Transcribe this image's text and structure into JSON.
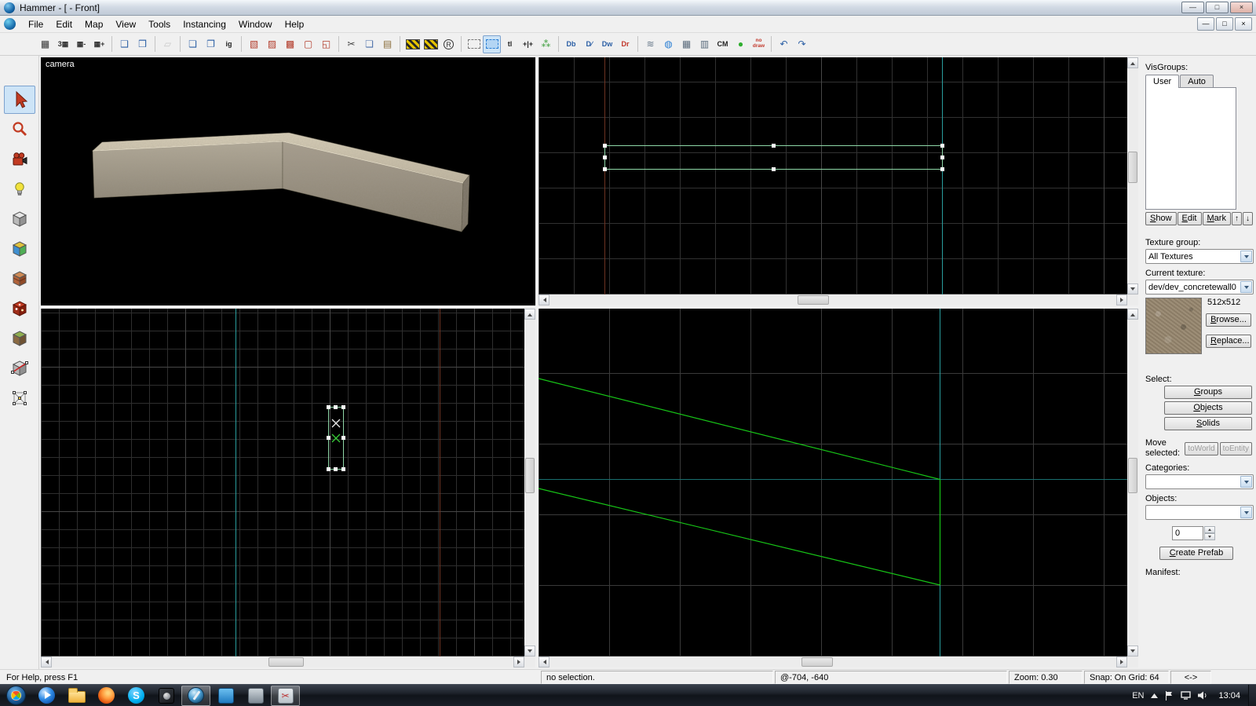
{
  "titlebar": {
    "title": "Hammer - [ - Front]",
    "minimize_glyph": "—",
    "maximize_glyph": "□",
    "close_glyph": "×"
  },
  "menubar": {
    "items": [
      {
        "label": "File",
        "name": "menu-file"
      },
      {
        "label": "Edit",
        "name": "menu-edit"
      },
      {
        "label": "Map",
        "name": "menu-map"
      },
      {
        "label": "View",
        "name": "menu-view"
      },
      {
        "label": "Tools",
        "name": "menu-tools"
      },
      {
        "label": "Instancing",
        "name": "menu-instancing"
      },
      {
        "label": "Window",
        "name": "menu-window"
      },
      {
        "label": "Help",
        "name": "menu-help"
      }
    ],
    "mdi_minimize": "—",
    "mdi_restore": "□",
    "mdi_close": "×"
  },
  "toolbar": {
    "buttons": [
      {
        "name": "toggle-grid-icon",
        "glyph": "▦",
        "color": "#333333"
      },
      {
        "name": "toggle-3d-grid-icon",
        "glyph": "3▦",
        "color": "#333333",
        "cls": "small-text"
      },
      {
        "name": "smaller-grid-icon",
        "glyph": "▦-",
        "color": "#333333",
        "cls": "small-text"
      },
      {
        "name": "larger-grid-icon",
        "glyph": "▦+",
        "color": "#333333",
        "cls": "small-text"
      },
      {
        "sep": true
      },
      {
        "name": "load-window-state-icon",
        "glyph": "❑",
        "color": "#2b5fa5"
      },
      {
        "name": "save-window-state-icon",
        "glyph": "❒",
        "color": "#2b5fa5"
      },
      {
        "sep": true
      },
      {
        "name": "carve-icon",
        "glyph": "▱",
        "color": "#9a9a9a",
        "disabled": true
      },
      {
        "sep": true
      },
      {
        "name": "group-icon",
        "glyph": "❏",
        "color": "#2b5fa5"
      },
      {
        "name": "ungroup-icon",
        "glyph": "❐",
        "color": "#2b5fa5"
      },
      {
        "name": "ignore-groups-icon",
        "glyph": "ig",
        "color": "#222222",
        "cls": "small-text"
      },
      {
        "sep": true
      },
      {
        "name": "hide-selected-icon",
        "glyph": "▧",
        "color": "#b23b2a"
      },
      {
        "name": "hide-unselected-icon",
        "glyph": "▨",
        "color": "#b23b2a"
      },
      {
        "name": "show-all-icon",
        "glyph": "▩",
        "color": "#b23b2a"
      },
      {
        "name": "cordon-toggle-icon",
        "glyph": "▢",
        "color": "#b23b2a"
      },
      {
        "name": "cordon-edit-icon",
        "glyph": "◱",
        "color": "#b23b2a"
      },
      {
        "sep": true
      },
      {
        "name": "cut-icon",
        "glyph": "✂",
        "color": "#444444"
      },
      {
        "name": "copy-icon",
        "glyph": "❏",
        "color": "#4a6ea9"
      },
      {
        "name": "paste-icon",
        "glyph": "▤",
        "color": "#8a6d3b"
      },
      {
        "sep": true
      },
      {
        "name": "texture-lock-icon",
        "cls": "hazard"
      },
      {
        "name": "texture-scale-lock-icon",
        "cls": "hazard"
      },
      {
        "name": "model-render-distance-icon",
        "glyph": "R",
        "color": "#333333",
        "cls": "circled"
      },
      {
        "sep": true
      },
      {
        "name": "select-box-icon",
        "cls": "dashed-box"
      },
      {
        "name": "auto-select-icon",
        "cls": "dashed-box-blue",
        "active": true
      },
      {
        "name": "texture-lock-tl-icon",
        "glyph": "tl",
        "color": "#222222",
        "cls": "small-text"
      },
      {
        "name": "edge-align-icon",
        "glyph": "+|+",
        "color": "#222222",
        "cls": "small-text"
      },
      {
        "name": "foliage-icon",
        "glyph": "⁂",
        "color": "#3d9e3d"
      },
      {
        "sep": true
      },
      {
        "name": "disp-boundary-icon",
        "glyph": "Db",
        "color": "#2b5fa5",
        "cls": "small-text"
      },
      {
        "name": "disp-collision-icon",
        "glyph": "D∕",
        "color": "#2b5fa5",
        "cls": "small-text"
      },
      {
        "name": "disp-walkable-icon",
        "glyph": "Dw",
        "color": "#2b5fa5",
        "cls": "small-text"
      },
      {
        "name": "disp-remove-icon",
        "glyph": "Dr",
        "color": "#c2372a",
        "cls": "small-text"
      },
      {
        "sep": true
      },
      {
        "name": "sound-browser-icon",
        "glyph": "≋",
        "color": "#6b7c8d"
      },
      {
        "name": "model-browser-icon",
        "glyph": "◍",
        "color": "#2b7fd4"
      },
      {
        "name": "entity-report-icon",
        "glyph": "▦",
        "color": "#5a6b7c"
      },
      {
        "name": "face-edit-icon",
        "glyph": "▥",
        "color": "#5a6b7c"
      },
      {
        "name": "cordon-mode-icon",
        "glyph": "CM",
        "color": "#222222",
        "cls": "small-text"
      },
      {
        "name": "run-map-icon",
        "glyph": "●",
        "color": "#2fae2f"
      },
      {
        "name": "nodraw-icon",
        "glyph": "no\ndraw",
        "color": "#c2372a",
        "cls": "tiny-text"
      },
      {
        "sep": true
      },
      {
        "name": "undo-icon",
        "glyph": "↶",
        "color": "#2b5fa5"
      },
      {
        "name": "redo-icon",
        "glyph": "↷",
        "color": "#2b5fa5"
      }
    ]
  },
  "tool_palette": {
    "tools": [
      "selection",
      "magnify",
      "camera",
      "entity",
      "block",
      "texture-application",
      "apply-current-texture",
      "apply-decals",
      "apply-overlays",
      "clipping",
      "vertex-manipulation"
    ],
    "active_tool": "selection"
  },
  "viewports": {
    "camera_label": "camera",
    "colors": {
      "background": "#000000",
      "grid_line": "#313131",
      "grid_major_line": "#474747",
      "selection_outline": "#8fd8a8",
      "brush_wireframe": "#17c517",
      "axis_teal": "#2a9d9d",
      "axis_brown": "#6e3322",
      "handle": "#ffffff"
    }
  },
  "right_panel": {
    "visgroups_label": "VisGroups:",
    "tabs": [
      {
        "label": "User",
        "name": "tab-user",
        "active": true
      },
      {
        "label": "Auto",
        "name": "tab-auto"
      }
    ],
    "show_btn": "Show",
    "edit_btn": "Edit",
    "mark_btn": "Mark",
    "up_btn": "↑",
    "down_btn": "↓",
    "texture_group_label": "Texture group:",
    "texture_group_value": "All Textures",
    "current_texture_label": "Current texture:",
    "current_texture_value": "dev/dev_concretewall0",
    "texture_size": "512x512",
    "browse_btn": "Browse...",
    "replace_btn": "Replace...",
    "select_label": "Select:",
    "groups_btn": "Groups",
    "objects_btn": "Objects",
    "solids_btn": "Solids",
    "move_label_1": "Move",
    "move_label_2": "selected:",
    "toworld_btn": "toWorld",
    "toentity_btn": "toEntity",
    "categories_label": "Categories:",
    "objects_label": "Objects:",
    "prefab_count": "0",
    "create_prefab_btn": "Create Prefab",
    "manifest_label": "Manifest:"
  },
  "status_bar": {
    "help": "For Help, press F1",
    "selection": "no selection.",
    "coords": "@-704, -640",
    "zoom": "Zoom: 0.30",
    "snap": "Snap: On Grid: 64",
    "resize": "<->"
  },
  "taskbar": {
    "language": "EN",
    "time": "13:04",
    "apps": [
      "Windows Media Player",
      "Windows Explorer",
      "Firefox",
      "Skype",
      "Media App",
      "Hammer",
      "Messenger",
      "Utility",
      "Snipping Tool"
    ]
  }
}
